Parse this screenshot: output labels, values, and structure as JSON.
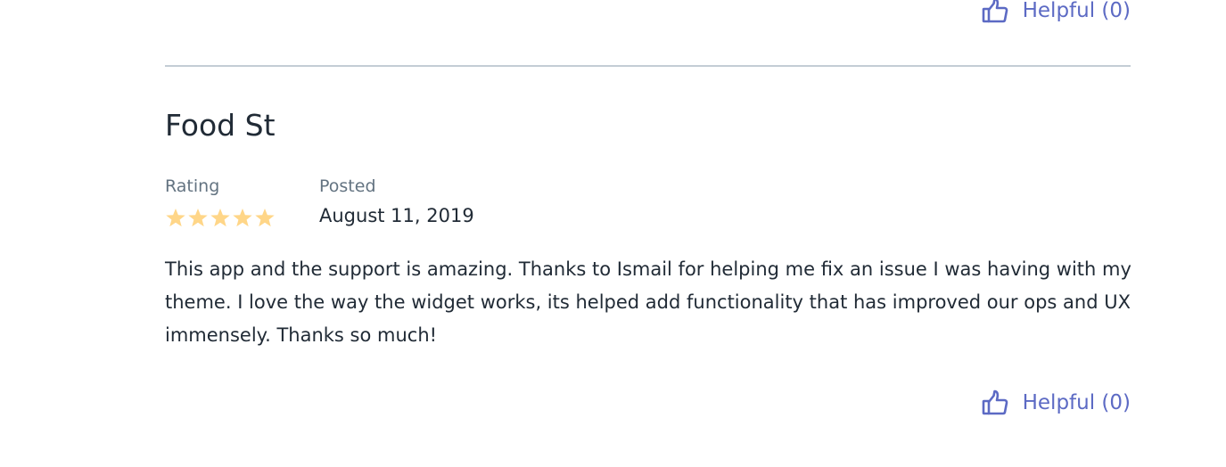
{
  "review_above": {
    "helpful_label": "Helpful (0)"
  },
  "review": {
    "reviewer_name": "Food St",
    "rating_label": "Rating",
    "rating_value": 5,
    "rating_max": 5,
    "star_color": "#ffd688",
    "posted_label": "Posted",
    "posted_date": "August 11, 2019",
    "body": "This app and the support is amazing. Thanks to Ismail for helping me fix an issue I was having with my theme. I love the way the widget works, its helped add functionality that has improved our ops and UX immensely. Thanks so much!",
    "helpful_label": "Helpful (0)"
  },
  "colors": {
    "accent": "#5c6ac4",
    "divider": "#c4cdd5",
    "muted_text": "#637381",
    "text": "#212b36"
  },
  "icons": {
    "helpful": "thumbs-up-icon",
    "rating": "star-icon"
  }
}
